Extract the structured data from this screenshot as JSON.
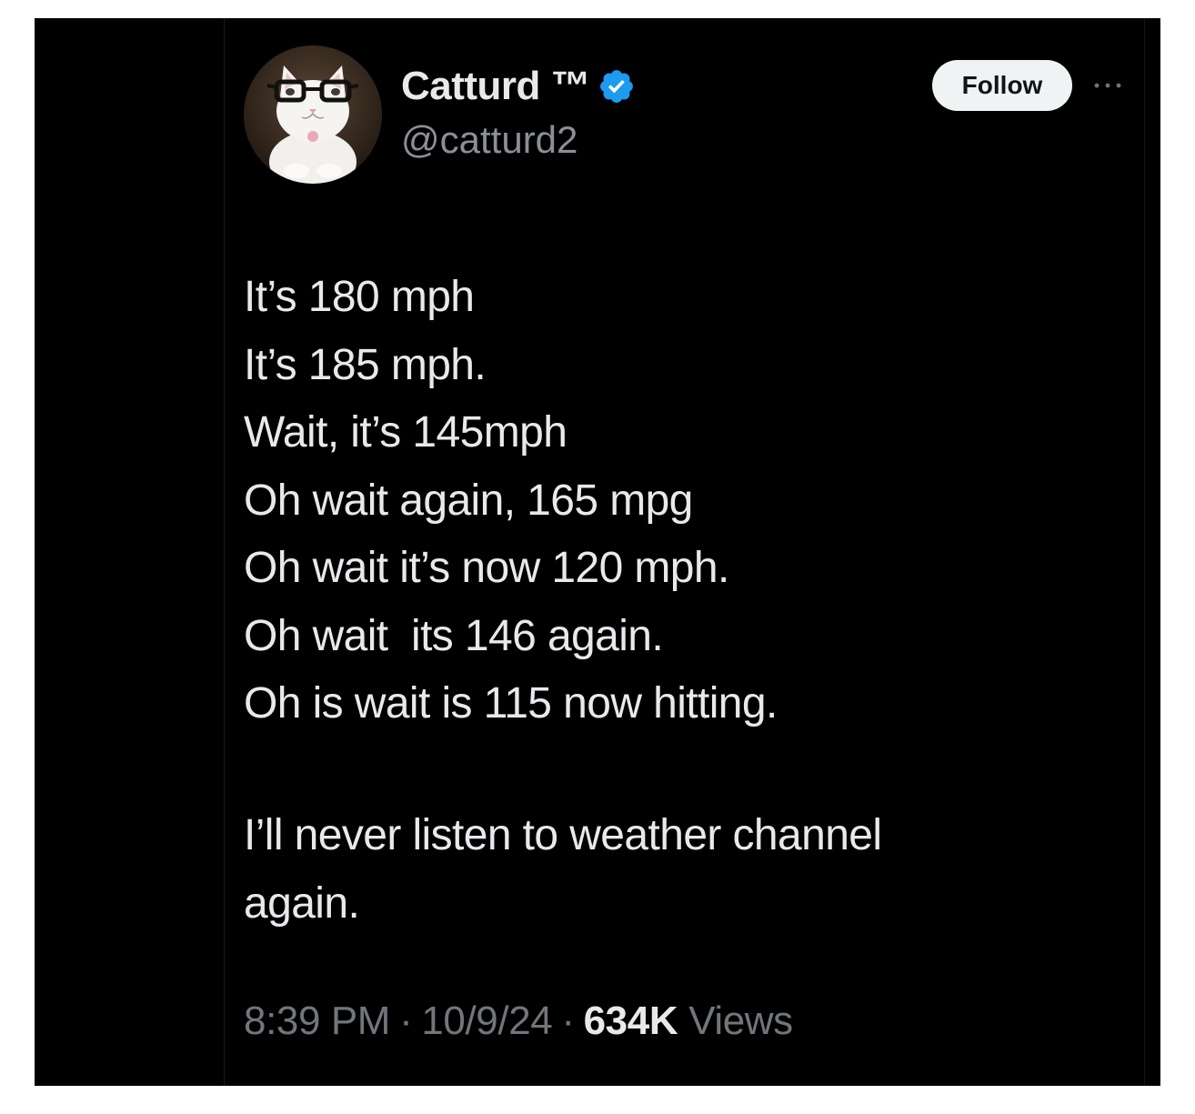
{
  "user": {
    "display_name": "Catturd ™",
    "handle": "@catturd2",
    "verified": true,
    "verified_color": "#1d9bf0"
  },
  "actions": {
    "follow_label": "Follow",
    "more_icon": "ellipsis-icon"
  },
  "tweet": {
    "lines": [
      "It’s 180 mph",
      "It’s 185 mph.",
      "Wait, it’s 145mph",
      "Oh wait again, 165 mpg",
      "Oh wait it’s now 120 mph.",
      "Oh wait  its 146 again.",
      "Oh is wait is 115 now hitting."
    ],
    "closing_lines": [
      "I’ll never listen to weather channel",
      "again."
    ]
  },
  "meta": {
    "time": "8:39 PM",
    "separator": "·",
    "date": "10/9/24",
    "views_count": "634K",
    "views_label": "Views"
  },
  "colors": {
    "background": "#000000",
    "text_primary": "#e7e9ea",
    "text_secondary": "#71767b",
    "follow_bg": "#eff3f4"
  }
}
